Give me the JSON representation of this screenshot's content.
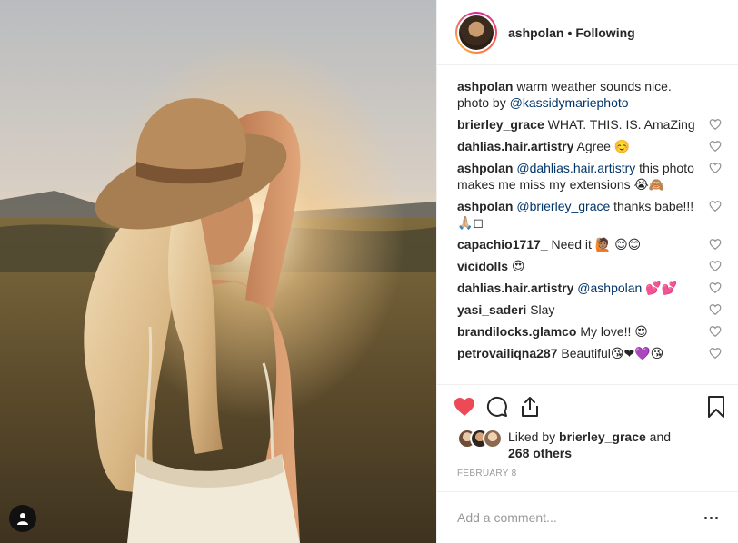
{
  "header": {
    "username": "ashpolan",
    "separator": "•",
    "follow_status": "Following"
  },
  "caption": {
    "username": "ashpolan",
    "text": "warm weather sounds nice. photo by ",
    "mention": "@kassidymariephoto"
  },
  "comments": [
    {
      "username": "brierley_grace",
      "text": "WHAT. THIS. IS. AmaZing"
    },
    {
      "username": "dahlias.hair.artistry",
      "text": "Agree ☺️"
    },
    {
      "username": "ashpolan",
      "mention": "@dahlias.hair.artistry",
      "text": " this photo makes me miss my extensions 😭🙈"
    },
    {
      "username": "ashpolan",
      "mention": "@brierley_grace",
      "text": " thanks babe!!! 🙏🏼◻"
    },
    {
      "username": "capachio1717_",
      "text": "Need it 🙋🏽 😊😊"
    },
    {
      "username": "vicidolls",
      "text": "😍"
    },
    {
      "username": "dahlias.hair.artistry",
      "mention": "@ashpolan",
      "text": " 💕💕"
    },
    {
      "username": "yasi_saderi",
      "text": "Slay"
    },
    {
      "username": "brandilocks.glamco",
      "text": "My love!! 😍"
    },
    {
      "username": "petrovailiqna287",
      "text": "Beautiful😘❤💜😘"
    }
  ],
  "likes": {
    "prefix": "Liked by ",
    "user": "brierley_grace",
    "and": " and ",
    "others": "268 others"
  },
  "date": "February 8",
  "add_comment": {
    "placeholder": "Add a comment..."
  },
  "colors": {
    "like_red": "#ed4956",
    "mention_blue": "#003569",
    "text": "#262626",
    "muted": "#999999"
  },
  "icons": {
    "like": "heart-filled-icon",
    "comment": "comment-bubble-icon",
    "share": "share-icon",
    "save": "bookmark-icon",
    "more": "more-options-icon",
    "tag": "user-tag-icon"
  }
}
